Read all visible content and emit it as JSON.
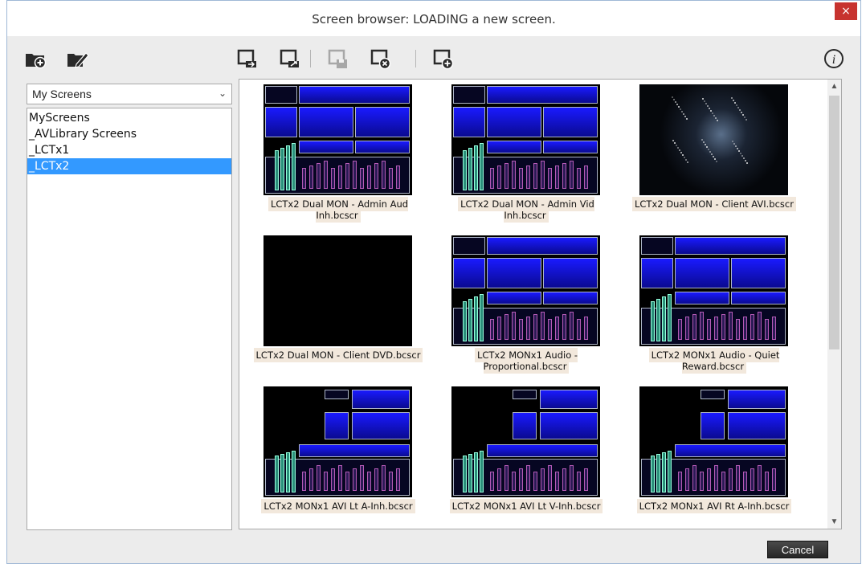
{
  "window": {
    "title": "Screen browser: LOADING a new screen.",
    "close_glyph": "×"
  },
  "toolbar": {
    "icons": [
      "new-folder-icon",
      "edit-folder-icon",
      "import-screen-icon",
      "export-screen-icon",
      "save-screen-icon",
      "delete-screen-icon",
      "new-screen-icon",
      "info-icon"
    ],
    "info_glyph": "i"
  },
  "sidebar": {
    "dropdown_value": "My Screens",
    "dropdown_chevron": "⌄",
    "items": [
      {
        "label": "MyScreens"
      },
      {
        "label": "_AVLibrary Screens"
      },
      {
        "label": "_LCTx1"
      },
      {
        "label": "_LCTx2"
      }
    ],
    "selected": "_LCTx2"
  },
  "screens": [
    {
      "name": "LCTx2 Dual MON - Admin Aud Inh.bcscr",
      "thumb": "dual"
    },
    {
      "name": "LCTx2 Dual MON - Admin Vid Inh.bcscr",
      "thumb": "dual"
    },
    {
      "name": "LCTx2 Dual MON - Client AVI.bcscr",
      "thumb": "video"
    },
    {
      "name": "LCTx2 Dual MON - Client DVD.bcscr",
      "thumb": "black"
    },
    {
      "name": "LCTx2 MONx1 Audio - Proportional.bcscr",
      "thumb": "dual"
    },
    {
      "name": "LCTx2 MONx1 Audio - Quiet Reward.bcscr",
      "thumb": "dual"
    },
    {
      "name": "LCTx2 MONx1 AVI Lt A-Inh.bcscr",
      "thumb": "mon"
    },
    {
      "name": "LCTx2 MONx1 AVI Lt V-Inh.bcscr",
      "thumb": "mon"
    },
    {
      "name": "LCTx2 MONx1 AVI Rt A-Inh.bcscr",
      "thumb": "mon"
    }
  ],
  "scrollbar": {
    "up": "▲",
    "down": "▼"
  },
  "footer": {
    "cancel_label": "Cancel"
  },
  "colors": {
    "selection": "#3399ff",
    "close": "#c7332f",
    "caption_bg": "#f2e8dc",
    "thumb_blue": "#1a1aff"
  }
}
